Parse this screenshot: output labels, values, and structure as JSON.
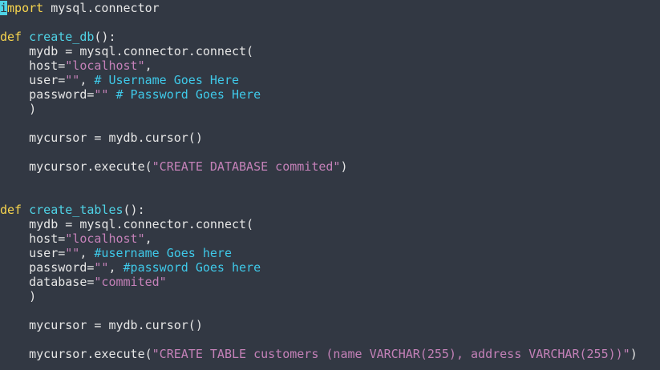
{
  "lines": [
    [
      {
        "t": "i",
        "c": "cursor"
      },
      {
        "t": "mport",
        "c": "kw"
      },
      {
        "t": " mysql.connector",
        "c": "plain"
      }
    ],
    [],
    [
      {
        "t": "def",
        "c": "kw"
      },
      {
        "t": " ",
        "c": "plain"
      },
      {
        "t": "create_db",
        "c": "fn"
      },
      {
        "t": "():",
        "c": "plain"
      }
    ],
    [
      {
        "t": "    mydb = mysql.connector.connect(",
        "c": "plain"
      }
    ],
    [
      {
        "t": "    host=",
        "c": "plain"
      },
      {
        "t": "\"localhost\"",
        "c": "str"
      },
      {
        "t": ",",
        "c": "plain"
      }
    ],
    [
      {
        "t": "    user=",
        "c": "plain"
      },
      {
        "t": "\"\"",
        "c": "str"
      },
      {
        "t": ", ",
        "c": "plain"
      },
      {
        "t": "# Username Goes Here",
        "c": "cm"
      }
    ],
    [
      {
        "t": "    password=",
        "c": "plain"
      },
      {
        "t": "\"\"",
        "c": "str"
      },
      {
        "t": " ",
        "c": "plain"
      },
      {
        "t": "# Password Goes Here",
        "c": "cm"
      }
    ],
    [
      {
        "t": "    )",
        "c": "plain"
      }
    ],
    [],
    [
      {
        "t": "    mycursor = mydb.cursor()",
        "c": "plain"
      }
    ],
    [],
    [
      {
        "t": "    mycursor.execute(",
        "c": "plain"
      },
      {
        "t": "\"CREATE DATABASE commited\"",
        "c": "str"
      },
      {
        "t": ")",
        "c": "plain"
      }
    ],
    [],
    [],
    [
      {
        "t": "def",
        "c": "kw"
      },
      {
        "t": " ",
        "c": "plain"
      },
      {
        "t": "create_tables",
        "c": "fn"
      },
      {
        "t": "():",
        "c": "plain"
      }
    ],
    [
      {
        "t": "    mydb = mysql.connector.connect(",
        "c": "plain"
      }
    ],
    [
      {
        "t": "    host=",
        "c": "plain"
      },
      {
        "t": "\"localhost\"",
        "c": "str"
      },
      {
        "t": ",",
        "c": "plain"
      }
    ],
    [
      {
        "t": "    user=",
        "c": "plain"
      },
      {
        "t": "\"\"",
        "c": "str"
      },
      {
        "t": ", ",
        "c": "plain"
      },
      {
        "t": "#username Goes here",
        "c": "cm"
      }
    ],
    [
      {
        "t": "    password=",
        "c": "plain"
      },
      {
        "t": "\"\"",
        "c": "str"
      },
      {
        "t": ", ",
        "c": "plain"
      },
      {
        "t": "#password Goes here",
        "c": "cm"
      }
    ],
    [
      {
        "t": "    database=",
        "c": "plain"
      },
      {
        "t": "\"commited\"",
        "c": "str"
      }
    ],
    [
      {
        "t": "    )",
        "c": "plain"
      }
    ],
    [],
    [
      {
        "t": "    mycursor = mydb.cursor()",
        "c": "plain"
      }
    ],
    [],
    [
      {
        "t": "    mycursor.execute(",
        "c": "plain"
      },
      {
        "t": "\"CREATE TABLE customers (name VARCHAR(255), address VARCHAR(255))\"",
        "c": "str"
      },
      {
        "t": ")",
        "c": "plain"
      }
    ]
  ],
  "colors": {
    "background": "#323843",
    "keyword": "#f6d44e",
    "function": "#4fd3e6",
    "string": "#c481b8",
    "comment": "#3fc9e9",
    "text": "#e6e6e6"
  }
}
